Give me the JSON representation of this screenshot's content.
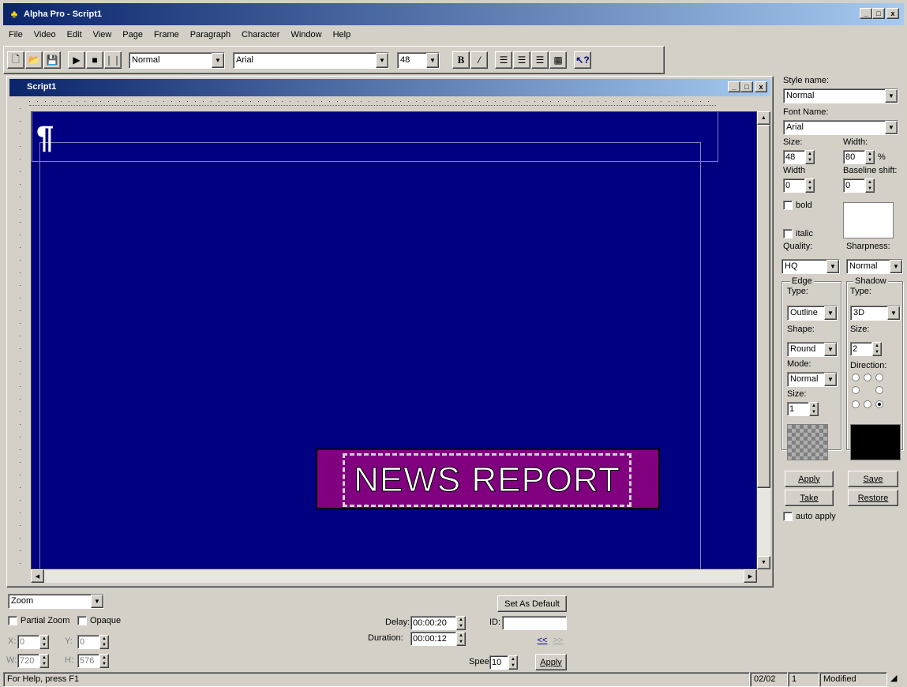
{
  "window": {
    "title": "Alpha Pro - Script1",
    "min": "_",
    "max": "□",
    "close": "x"
  },
  "menu": [
    "File",
    "Video",
    "Edit",
    "View",
    "Page",
    "Frame",
    "Paragraph",
    "Character",
    "Window",
    "Help"
  ],
  "toolbar": {
    "style": "Normal",
    "font": "Arial",
    "size": "48",
    "bold": "B",
    "italic": "/"
  },
  "document": {
    "title": "Script1",
    "text": "NEWS REPORT",
    "pilcrow": "¶",
    "colors": {
      "background": "#000080",
      "box": "#800080"
    }
  },
  "panel": {
    "style_name_label": "Style name:",
    "style_name": "Normal",
    "font_name_label": "Font Name:",
    "font_name": "Arial",
    "size_label": "Size:",
    "size": "48",
    "width_pct_label": "Width:",
    "width_pct": "80",
    "pct": "%",
    "width_label": "Width",
    "width": "0",
    "baseline_label": "Baseline shift:",
    "baseline": "0",
    "bold_label": "bold",
    "italic_label": "italic",
    "quality_label": "Quality:",
    "quality": "HQ",
    "sharpness_label": "Sharpness:",
    "sharpness": "Normal",
    "edge_group": "Edge",
    "edge_type_label": "Type:",
    "edge_type": "Outline",
    "shape_label": "Shape:",
    "shape": "Round",
    "mode_label": "Mode:",
    "mode": "Normal",
    "edge_size_label": "Size:",
    "edge_size": "1",
    "shadow_group": "Shadow",
    "shadow_type_label": "Type:",
    "shadow_type": "3D",
    "shadow_size_label": "Size:",
    "shadow_size": "2",
    "direction_label": "Direction:",
    "apply": "Apply",
    "save": "Save",
    "take": "Take",
    "restore": "Restore",
    "auto_apply": "auto apply"
  },
  "bottom": {
    "zoom": "Zoom",
    "partial_zoom": "Partial Zoom",
    "opaque": "Opaque",
    "x_label": "X:",
    "x": "0",
    "y_label": "Y:",
    "y": "0",
    "w_label": "W:",
    "w": "720",
    "h_label": "H:",
    "h": "576",
    "delay_label": "Delay:",
    "delay": "00:00:20",
    "duration_label": "Duration:",
    "duration": "00:00:12",
    "set_default": "Set As Default",
    "id_label": "ID:",
    "id": "",
    "prev": "<<",
    "next": ">>",
    "speed_label": "Speed",
    "speed": "10",
    "apply": "Apply"
  },
  "status": {
    "help": "For Help, press F1",
    "page": "02/02",
    "num": "1",
    "state": "Modified"
  }
}
